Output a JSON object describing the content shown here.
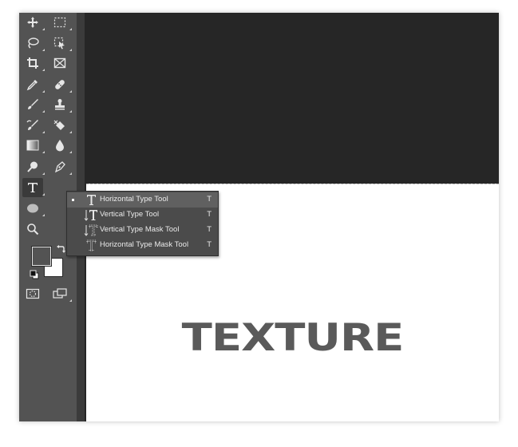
{
  "toolbar": {
    "tools": [
      {
        "name": "move-tool",
        "icon": "move-icon"
      },
      {
        "name": "rectangular-marquee-tool",
        "icon": "marquee-icon"
      },
      {
        "name": "lasso-tool",
        "icon": "lasso-icon"
      },
      {
        "name": "quick-selection-tool",
        "icon": "quick-selection-icon"
      },
      {
        "name": "crop-tool",
        "icon": "crop-icon"
      },
      {
        "name": "frame-tool",
        "icon": "frame-icon"
      },
      {
        "name": "eyedropper-tool",
        "icon": "eyedropper-icon"
      },
      {
        "name": "healing-brush-tool",
        "icon": "bandage-icon"
      },
      {
        "name": "brush-tool",
        "icon": "brush-icon"
      },
      {
        "name": "clone-stamp-tool",
        "icon": "stamp-icon"
      },
      {
        "name": "history-brush-tool",
        "icon": "history-brush-icon"
      },
      {
        "name": "eraser-tool",
        "icon": "eraser-icon"
      },
      {
        "name": "gradient-tool",
        "icon": "gradient-icon"
      },
      {
        "name": "blur-tool",
        "icon": "drop-icon"
      },
      {
        "name": "dodge-tool",
        "icon": "dodge-icon"
      },
      {
        "name": "pen-tool",
        "icon": "pen-icon"
      },
      {
        "name": "type-tool",
        "icon": "type-icon",
        "active": true
      },
      {
        "name": "ellipse-tool",
        "icon": "ellipse-icon"
      },
      {
        "name": "zoom-tool",
        "icon": "zoom-icon"
      }
    ],
    "foreground_color": "#535353",
    "background_color": "#ffffff"
  },
  "type_flyout": {
    "items": [
      {
        "label": "Horizontal Type Tool",
        "shortcut": "T",
        "icon": "horizontal-type-icon",
        "selected": true
      },
      {
        "label": "Vertical Type Tool",
        "shortcut": "T",
        "icon": "vertical-type-icon",
        "selected": false
      },
      {
        "label": "Vertical Type Mask Tool",
        "shortcut": "T",
        "icon": "vertical-type-mask-icon",
        "selected": false
      },
      {
        "label": "Horizontal Type Mask Tool",
        "shortcut": "T",
        "icon": "horizontal-type-mask-icon",
        "selected": false
      }
    ]
  },
  "canvas": {
    "text": "TEXTURE",
    "text_color": "#5a5a5a",
    "pasteboard_color": "#262626",
    "document_color": "#ffffff"
  }
}
